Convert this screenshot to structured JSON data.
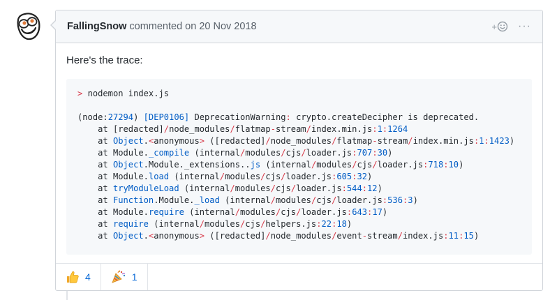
{
  "comment": {
    "author": "FallingSnow",
    "action": "commented on",
    "date": "20 Nov 2018",
    "add_reaction_plus": "+",
    "more_label": "···",
    "intro": "Here's the trace:",
    "code_lines": [
      [
        {
          "t": "> ",
          "c": "kw"
        },
        {
          "t": "nodemon index.js"
        }
      ],
      [],
      [
        {
          "t": "(node:"
        },
        {
          "t": "27294",
          "c": "bl"
        },
        {
          "t": ") "
        },
        {
          "t": "[DEP0106]",
          "c": "bl"
        },
        {
          "t": " DeprecationWarning"
        },
        {
          "t": ":",
          "c": "kw"
        },
        {
          "t": " crypto.createDecipher is deprecated."
        }
      ],
      [
        {
          "t": "    at [redacted]"
        },
        {
          "t": "/",
          "c": "kw"
        },
        {
          "t": "node_modules"
        },
        {
          "t": "/",
          "c": "kw"
        },
        {
          "t": "flatmap"
        },
        {
          "t": "-",
          "c": "kw"
        },
        {
          "t": "stream"
        },
        {
          "t": "/",
          "c": "kw"
        },
        {
          "t": "index.min.js"
        },
        {
          "t": ":",
          "c": "kw"
        },
        {
          "t": "1",
          "c": "bl"
        },
        {
          "t": ":",
          "c": "kw"
        },
        {
          "t": "1264",
          "c": "bl"
        }
      ],
      [
        {
          "t": "    at "
        },
        {
          "t": "Object",
          "c": "bl"
        },
        {
          "t": "."
        },
        {
          "t": "<",
          "c": "kw"
        },
        {
          "t": "anonymous"
        },
        {
          "t": ">",
          "c": "kw"
        },
        {
          "t": " ([redacted]"
        },
        {
          "t": "/",
          "c": "kw"
        },
        {
          "t": "node_modules"
        },
        {
          "t": "/",
          "c": "kw"
        },
        {
          "t": "flatmap"
        },
        {
          "t": "-",
          "c": "kw"
        },
        {
          "t": "stream"
        },
        {
          "t": "/",
          "c": "kw"
        },
        {
          "t": "index.min.js"
        },
        {
          "t": ":",
          "c": "kw"
        },
        {
          "t": "1",
          "c": "bl"
        },
        {
          "t": ":",
          "c": "kw"
        },
        {
          "t": "1423",
          "c": "bl"
        },
        {
          "t": ")"
        }
      ],
      [
        {
          "t": "    at Module."
        },
        {
          "t": "_compile",
          "c": "bl"
        },
        {
          "t": " (internal"
        },
        {
          "t": "/",
          "c": "kw"
        },
        {
          "t": "modules"
        },
        {
          "t": "/",
          "c": "kw"
        },
        {
          "t": "cjs"
        },
        {
          "t": "/",
          "c": "kw"
        },
        {
          "t": "loader.js"
        },
        {
          "t": ":",
          "c": "kw"
        },
        {
          "t": "707",
          "c": "bl"
        },
        {
          "t": ":",
          "c": "kw"
        },
        {
          "t": "30",
          "c": "bl"
        },
        {
          "t": ")"
        }
      ],
      [
        {
          "t": "    at "
        },
        {
          "t": "Object",
          "c": "bl"
        },
        {
          "t": ".Module._extensions.."
        },
        {
          "t": "js",
          "c": "bl"
        },
        {
          "t": " (internal"
        },
        {
          "t": "/",
          "c": "kw"
        },
        {
          "t": "modules"
        },
        {
          "t": "/",
          "c": "kw"
        },
        {
          "t": "cjs"
        },
        {
          "t": "/",
          "c": "kw"
        },
        {
          "t": "loader.js"
        },
        {
          "t": ":",
          "c": "kw"
        },
        {
          "t": "718",
          "c": "bl"
        },
        {
          "t": ":",
          "c": "kw"
        },
        {
          "t": "10",
          "c": "bl"
        },
        {
          "t": ")"
        }
      ],
      [
        {
          "t": "    at Module."
        },
        {
          "t": "load",
          "c": "bl"
        },
        {
          "t": " (internal"
        },
        {
          "t": "/",
          "c": "kw"
        },
        {
          "t": "modules"
        },
        {
          "t": "/",
          "c": "kw"
        },
        {
          "t": "cjs"
        },
        {
          "t": "/",
          "c": "kw"
        },
        {
          "t": "loader.js"
        },
        {
          "t": ":",
          "c": "kw"
        },
        {
          "t": "605",
          "c": "bl"
        },
        {
          "t": ":",
          "c": "kw"
        },
        {
          "t": "32",
          "c": "bl"
        },
        {
          "t": ")"
        }
      ],
      [
        {
          "t": "    at "
        },
        {
          "t": "tryModuleLoad",
          "c": "bl"
        },
        {
          "t": " (internal"
        },
        {
          "t": "/",
          "c": "kw"
        },
        {
          "t": "modules"
        },
        {
          "t": "/",
          "c": "kw"
        },
        {
          "t": "cjs"
        },
        {
          "t": "/",
          "c": "kw"
        },
        {
          "t": "loader.js"
        },
        {
          "t": ":",
          "c": "kw"
        },
        {
          "t": "544",
          "c": "bl"
        },
        {
          "t": ":",
          "c": "kw"
        },
        {
          "t": "12",
          "c": "bl"
        },
        {
          "t": ")"
        }
      ],
      [
        {
          "t": "    at "
        },
        {
          "t": "Function",
          "c": "bl"
        },
        {
          "t": ".Module."
        },
        {
          "t": "_load",
          "c": "bl"
        },
        {
          "t": " (internal"
        },
        {
          "t": "/",
          "c": "kw"
        },
        {
          "t": "modules"
        },
        {
          "t": "/",
          "c": "kw"
        },
        {
          "t": "cjs"
        },
        {
          "t": "/",
          "c": "kw"
        },
        {
          "t": "loader.js"
        },
        {
          "t": ":",
          "c": "kw"
        },
        {
          "t": "536",
          "c": "bl"
        },
        {
          "t": ":",
          "c": "kw"
        },
        {
          "t": "3",
          "c": "bl"
        },
        {
          "t": ")"
        }
      ],
      [
        {
          "t": "    at Module."
        },
        {
          "t": "require",
          "c": "bl"
        },
        {
          "t": " (internal"
        },
        {
          "t": "/",
          "c": "kw"
        },
        {
          "t": "modules"
        },
        {
          "t": "/",
          "c": "kw"
        },
        {
          "t": "cjs"
        },
        {
          "t": "/",
          "c": "kw"
        },
        {
          "t": "loader.js"
        },
        {
          "t": ":",
          "c": "kw"
        },
        {
          "t": "643",
          "c": "bl"
        },
        {
          "t": ":",
          "c": "kw"
        },
        {
          "t": "17",
          "c": "bl"
        },
        {
          "t": ")"
        }
      ],
      [
        {
          "t": "    at "
        },
        {
          "t": "require",
          "c": "bl"
        },
        {
          "t": " (internal"
        },
        {
          "t": "/",
          "c": "kw"
        },
        {
          "t": "modules"
        },
        {
          "t": "/",
          "c": "kw"
        },
        {
          "t": "cjs"
        },
        {
          "t": "/",
          "c": "kw"
        },
        {
          "t": "helpers.js"
        },
        {
          "t": ":",
          "c": "kw"
        },
        {
          "t": "22",
          "c": "bl"
        },
        {
          "t": ":",
          "c": "kw"
        },
        {
          "t": "18",
          "c": "bl"
        },
        {
          "t": ")"
        }
      ],
      [
        {
          "t": "    at "
        },
        {
          "t": "Object",
          "c": "bl"
        },
        {
          "t": "."
        },
        {
          "t": "<",
          "c": "kw"
        },
        {
          "t": "anonymous"
        },
        {
          "t": ">",
          "c": "kw"
        },
        {
          "t": " ([redacted]"
        },
        {
          "t": "/",
          "c": "kw"
        },
        {
          "t": "node_modules"
        },
        {
          "t": "/",
          "c": "kw"
        },
        {
          "t": "event"
        },
        {
          "t": "-",
          "c": "kw"
        },
        {
          "t": "stream"
        },
        {
          "t": "/",
          "c": "kw"
        },
        {
          "t": "index.js"
        },
        {
          "t": ":",
          "c": "kw"
        },
        {
          "t": "11",
          "c": "bl"
        },
        {
          "t": ":",
          "c": "kw"
        },
        {
          "t": "15",
          "c": "bl"
        },
        {
          "t": ")"
        }
      ]
    ]
  },
  "reactions": [
    {
      "icon": "thumbs-up-icon",
      "count": "4"
    },
    {
      "icon": "party-popper-icon",
      "count": "1"
    }
  ],
  "colors": {
    "header_bg": "#f6f8fa",
    "border": "#d1d5da",
    "link_blue": "#0366d6",
    "code_red": "#d73a49",
    "code_blue": "#005cc5"
  }
}
